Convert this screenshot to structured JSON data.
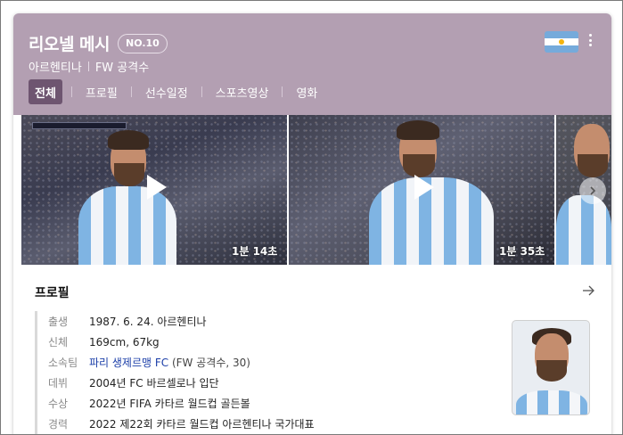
{
  "colors": {
    "header_bg": "#b39fb2",
    "active_tab_bg": "#6e5570",
    "link": "#1b3ea8"
  },
  "header": {
    "name": "리오넬 메시",
    "badge": "NO.10",
    "country": "아르헨티나",
    "position": "FW 공격수",
    "flag_icon": "argentina-flag-icon",
    "more_icon": "more-vertical-icon"
  },
  "tabs": [
    {
      "label": "전체",
      "active": true
    },
    {
      "label": "프로필",
      "active": false
    },
    {
      "label": "선수일정",
      "active": false
    },
    {
      "label": "스포츠영상",
      "active": false
    },
    {
      "label": "영화",
      "active": false
    }
  ],
  "videos": [
    {
      "duration": "1분 14초"
    },
    {
      "duration": "1분 35초"
    }
  ],
  "profile": {
    "title": "프로필",
    "rows": [
      {
        "label": "출생",
        "value": "1987. 6. 24. 아르헨티나"
      },
      {
        "label": "신체",
        "value": "169cm, 67kg"
      },
      {
        "label": "소속팀",
        "link": "파리 생제르맹 FC",
        "extra": " (FW 공격수, 30)"
      },
      {
        "label": "데뷔",
        "value": "2004년 FC 바르셀로나 입단"
      },
      {
        "label": "수상",
        "value": "2022년 FIFA 카타르 월드컵 골든볼"
      },
      {
        "label": "경력",
        "value": "2022 제22회 카타르 월드컵 아르헨티나 국가대표"
      }
    ]
  }
}
